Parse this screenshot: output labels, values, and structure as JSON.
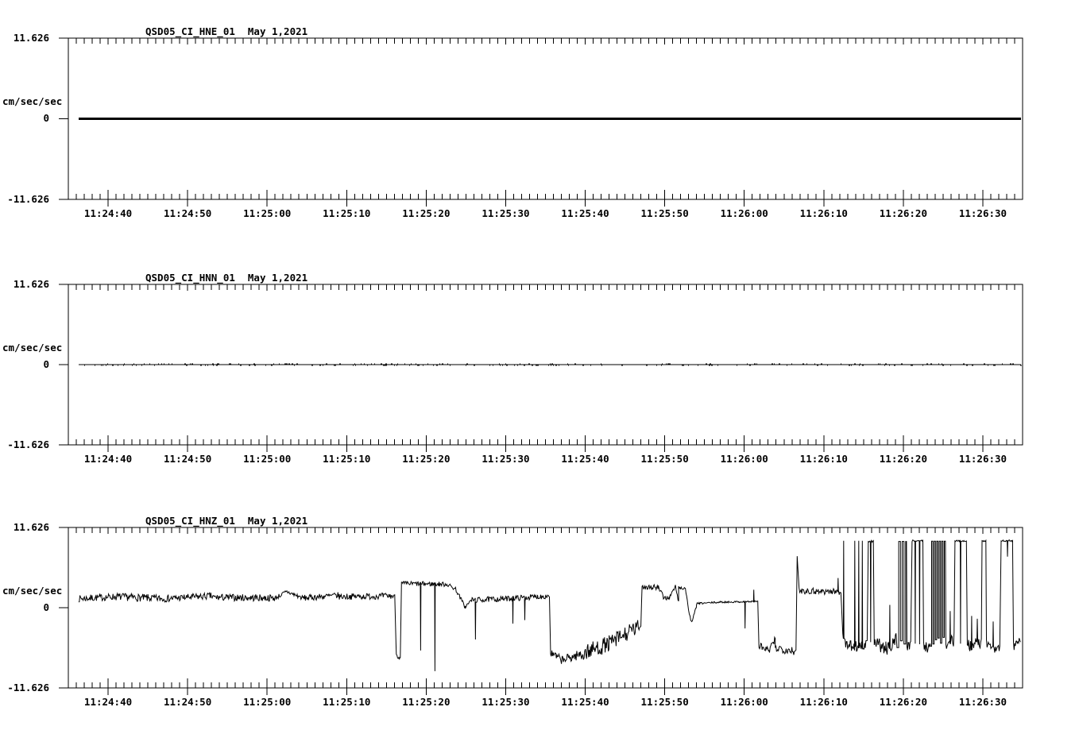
{
  "page": {
    "background": "#ffffff",
    "foreground": "#000000"
  },
  "chart_data": [
    {
      "type": "line",
      "title": "QSD05_CI_HNE_01",
      "date": "May 1,2021",
      "ylabel": "cm/sec/sec",
      "ylim": [
        -11.626,
        11.626
      ],
      "ytick_labels": [
        "11.626",
        "0",
        "-11.626"
      ],
      "x_start": "11:24:35",
      "x_end": "11:26:35",
      "x_major_tick_s": 10,
      "x_minor_tick_s": 1,
      "x_tick_labels": [
        "11:24:40",
        "11:24:50",
        "11:25:00",
        "11:25:10",
        "11:25:20",
        "11:25:30",
        "11:25:40",
        "11:25:50",
        "11:26:00",
        "11:26:10",
        "11:26:20",
        "11:26:30"
      ],
      "series": {
        "kind": "flat",
        "value": 0,
        "t0": 1.3,
        "t1": 119.8,
        "stroke_px": 3
      }
    },
    {
      "type": "line",
      "title": "QSD05_CI_HNN_01",
      "date": "May 1,2021",
      "ylabel": "cm/sec/sec",
      "ylim": [
        -11.626,
        11.626
      ],
      "ytick_labels": [
        "11.626",
        "0",
        "-11.626"
      ],
      "x_start": "11:24:35",
      "x_end": "11:26:35",
      "x_major_tick_s": 10,
      "x_minor_tick_s": 1,
      "x_tick_labels": [
        "11:24:40",
        "11:24:50",
        "11:25:00",
        "11:25:10",
        "11:25:20",
        "11:25:30",
        "11:25:40",
        "11:25:50",
        "11:26:00",
        "11:26:10",
        "11:26:20",
        "11:26:30"
      ],
      "series": {
        "kind": "noisy-flat",
        "value": 0,
        "noise": 0.05,
        "seed": 11,
        "t0": 1.3,
        "t1": 119.8,
        "stroke_px": 1
      }
    },
    {
      "type": "line",
      "title": "QSD05_CI_HNZ_01",
      "date": "May 1,2021",
      "ylabel": "cm/sec/sec",
      "ylim": [
        -11.626,
        11.626
      ],
      "ytick_labels": [
        "11.626",
        "0",
        "-11.626"
      ],
      "x_start": "11:24:35",
      "x_end": "11:26:35",
      "x_major_tick_s": 10,
      "x_minor_tick_s": 1,
      "x_tick_labels": [
        "11:24:40",
        "11:24:50",
        "11:25:00",
        "11:25:10",
        "11:25:20",
        "11:25:30",
        "11:25:40",
        "11:25:50",
        "11:26:00",
        "11:26:10",
        "11:26:20",
        "11:26:30"
      ],
      "series": {
        "kind": "segments",
        "dt": 0.08,
        "seed": 7,
        "stroke_px": 1,
        "parts": [
          {
            "seg": [
              1.3,
              6,
              1.3,
              1.6,
              0.5
            ]
          },
          {
            "seg": [
              6,
              12,
              1.6,
              1.3,
              0.55
            ]
          },
          {
            "seg": [
              12,
              18,
              1.3,
              1.7,
              0.5
            ]
          },
          {
            "seg": [
              18,
              26,
              1.5,
              1.4,
              0.5
            ]
          },
          {
            "seg": [
              26,
              27.5,
              1.4,
              2.3,
              0.35
            ]
          },
          {
            "seg": [
              27.5,
              29.5,
              2.3,
              1.4,
              0.35
            ]
          },
          {
            "seg": [
              29.5,
              34,
              1.4,
              1.8,
              0.45
            ]
          },
          {
            "seg": [
              34,
              41.0,
              1.6,
              1.7,
              0.45
            ]
          },
          {
            "seg": [
              41.05,
              41.25,
              1.7,
              -6.8,
              0.2
            ]
          },
          {
            "seg": [
              41.25,
              41.75,
              -6.8,
              -7.3,
              0.35
            ]
          },
          {
            "seg": [
              41.75,
              41.9,
              -7.3,
              3.3,
              0.1
            ]
          },
          {
            "seg": [
              41.9,
              47.6,
              3.5,
              3.4,
              0.35
            ]
          },
          {
            "seg": [
              47.6,
              48.7,
              3.4,
              2.7,
              0.3
            ]
          },
          {
            "seg": [
              48.7,
              49.9,
              2.7,
              0.1,
              0.3
            ]
          },
          {
            "seg": [
              49.9,
              50.7,
              0.1,
              1.1,
              0.25
            ]
          },
          {
            "seg": [
              50.7,
              55,
              1.1,
              1.3,
              0.4
            ]
          },
          {
            "seg": [
              55,
              60.4,
              1.3,
              1.7,
              0.4
            ]
          },
          {
            "seg": [
              60.5,
              60.65,
              1.6,
              -6.6,
              0.1
            ]
          },
          {
            "seg": [
              60.65,
              62.1,
              -6.6,
              -7.6,
              0.6
            ]
          },
          {
            "seg": [
              62.1,
              64.3,
              -7.6,
              -6.8,
              0.7
            ]
          },
          {
            "seg": [
              64.3,
              68,
              -6.8,
              -5.2,
              1.2
            ]
          },
          {
            "seg": [
              68,
              71.9,
              -5.2,
              -2.7,
              1.2
            ]
          },
          {
            "seg": [
              72.0,
              72.15,
              -2.7,
              3.7,
              0.1
            ]
          },
          {
            "seg": [
              72.15,
              74.2,
              3.1,
              2.9,
              0.5
            ]
          },
          {
            "seg": [
              74.2,
              74.9,
              2.9,
              1.4,
              0.35
            ]
          },
          {
            "seg": [
              74.9,
              75.6,
              1.4,
              1.5,
              0.35
            ]
          },
          {
            "seg": [
              75.6,
              76.35,
              1.5,
              3.1,
              0.25
            ]
          },
          {
            "seg": [
              76.35,
              76.75,
              3.1,
              0.9,
              0.25
            ]
          },
          {
            "seg": [
              76.75,
              77.6,
              2.9,
              2.8,
              0.25
            ]
          },
          {
            "seg": [
              77.6,
              78.1,
              2.8,
              -1.0,
              0.2
            ]
          },
          {
            "seg": [
              78.1,
              78.4,
              -1.0,
              -2.2,
              0.25
            ]
          },
          {
            "seg": [
              78.4,
              79.0,
              -2.2,
              0.3,
              0.2
            ]
          },
          {
            "seg": [
              79.0,
              82,
              0.6,
              0.8,
              0.13
            ]
          },
          {
            "seg": [
              82,
              86.6,
              0.8,
              0.9,
              0.12
            ]
          },
          {
            "seg": [
              86.7,
              86.85,
              0.9,
              -5.5,
              0.1
            ]
          },
          {
            "seg": [
              86.85,
              88.1,
              -5.5,
              -6.3,
              0.6
            ]
          },
          {
            "seg": [
              88.1,
              88.9,
              -6.3,
              -4.6,
              0.5
            ]
          },
          {
            "seg": [
              88.9,
              91.4,
              -5.8,
              -6.2,
              0.7
            ]
          },
          {
            "seg": [
              91.5,
              91.65,
              -6.2,
              7.3,
              0.1
            ]
          },
          {
            "seg": [
              91.65,
              91.9,
              7.3,
              2.7,
              0.2
            ]
          },
          {
            "seg": [
              91.9,
              97.1,
              2.5,
              2.3,
              0.5
            ]
          },
          {
            "seg": [
              97.15,
              97.45,
              2.3,
              -5.0,
              0.2
            ]
          },
          {
            "seg": [
              97.6,
              98.75,
              -5.2,
              -5.6,
              0.8
            ]
          },
          {
            "seg": [
              98.8,
              99.85,
              -5.6,
              -5.5,
              0.8
            ]
          },
          {
            "seg": [
              99.9,
              100.5,
              -5.6,
              -5.4,
              0.8
            ]
          },
          {
            "seg": [
              100.6,
              101.3,
              9.6,
              9.6,
              0.15
            ]
          },
          {
            "seg": [
              101.35,
              102.8,
              -4.6,
              -6.5,
              1.0
            ]
          },
          {
            "seg": [
              102.8,
              104.1,
              -6.0,
              -4.4,
              1.1
            ]
          },
          {
            "tel": [
              104.2,
              105.4,
              9.6,
              -5.2,
              0.22
            ]
          },
          {
            "seg": [
              105.45,
              106.0,
              -5.8,
              -5.2,
              0.7
            ]
          },
          {
            "seg": [
              106.1,
              107.5,
              9.7,
              9.7,
              0.12
            ]
          },
          {
            "seg": [
              107.55,
              108.35,
              -5.5,
              -5.8,
              0.8
            ]
          },
          {
            "tel": [
              108.4,
              110.3,
              9.65,
              -5.0,
              0.16
            ]
          },
          {
            "seg": [
              110.35,
              111.4,
              -5.3,
              -4.6,
              1.0
            ]
          },
          {
            "seg": [
              111.5,
              113.0,
              9.7,
              9.7,
              0.12
            ]
          },
          {
            "seg": [
              113.05,
              114.85,
              -5.6,
              -4.9,
              0.9
            ]
          },
          {
            "seg": [
              114.9,
              115.4,
              9.7,
              9.7,
              0.12
            ]
          },
          {
            "seg": [
              115.45,
              117.2,
              -5.4,
              -5.9,
              0.8
            ]
          },
          {
            "seg": [
              117.3,
              118.8,
              9.7,
              9.7,
              0.12
            ]
          },
          {
            "seg": [
              118.85,
              119.8,
              -5.6,
              -4.6,
              0.9
            ]
          }
        ],
        "spikes": [
          [
            44.3,
            -6.2
          ],
          [
            46.1,
            -9.2
          ],
          [
            51.2,
            -4.6
          ],
          [
            55.9,
            -2.3
          ],
          [
            57.4,
            -1.8
          ],
          [
            85.1,
            -3.0
          ],
          [
            86.2,
            2.6
          ],
          [
            96.8,
            4.3
          ],
          [
            97.5,
            9.7
          ],
          [
            98.9,
            9.7
          ],
          [
            99.4,
            9.7
          ],
          [
            99.85,
            9.7
          ],
          [
            100.9,
            -5.0
          ],
          [
            103.3,
            0.4
          ],
          [
            106.5,
            -5.2
          ],
          [
            107.05,
            -5.3
          ],
          [
            110.9,
            -0.5
          ],
          [
            112.2,
            -5.2
          ],
          [
            113.6,
            -1.2
          ],
          [
            114.3,
            -1.6
          ],
          [
            116.3,
            -2.0
          ],
          [
            118.1,
            7.4
          ]
        ]
      }
    }
  ]
}
